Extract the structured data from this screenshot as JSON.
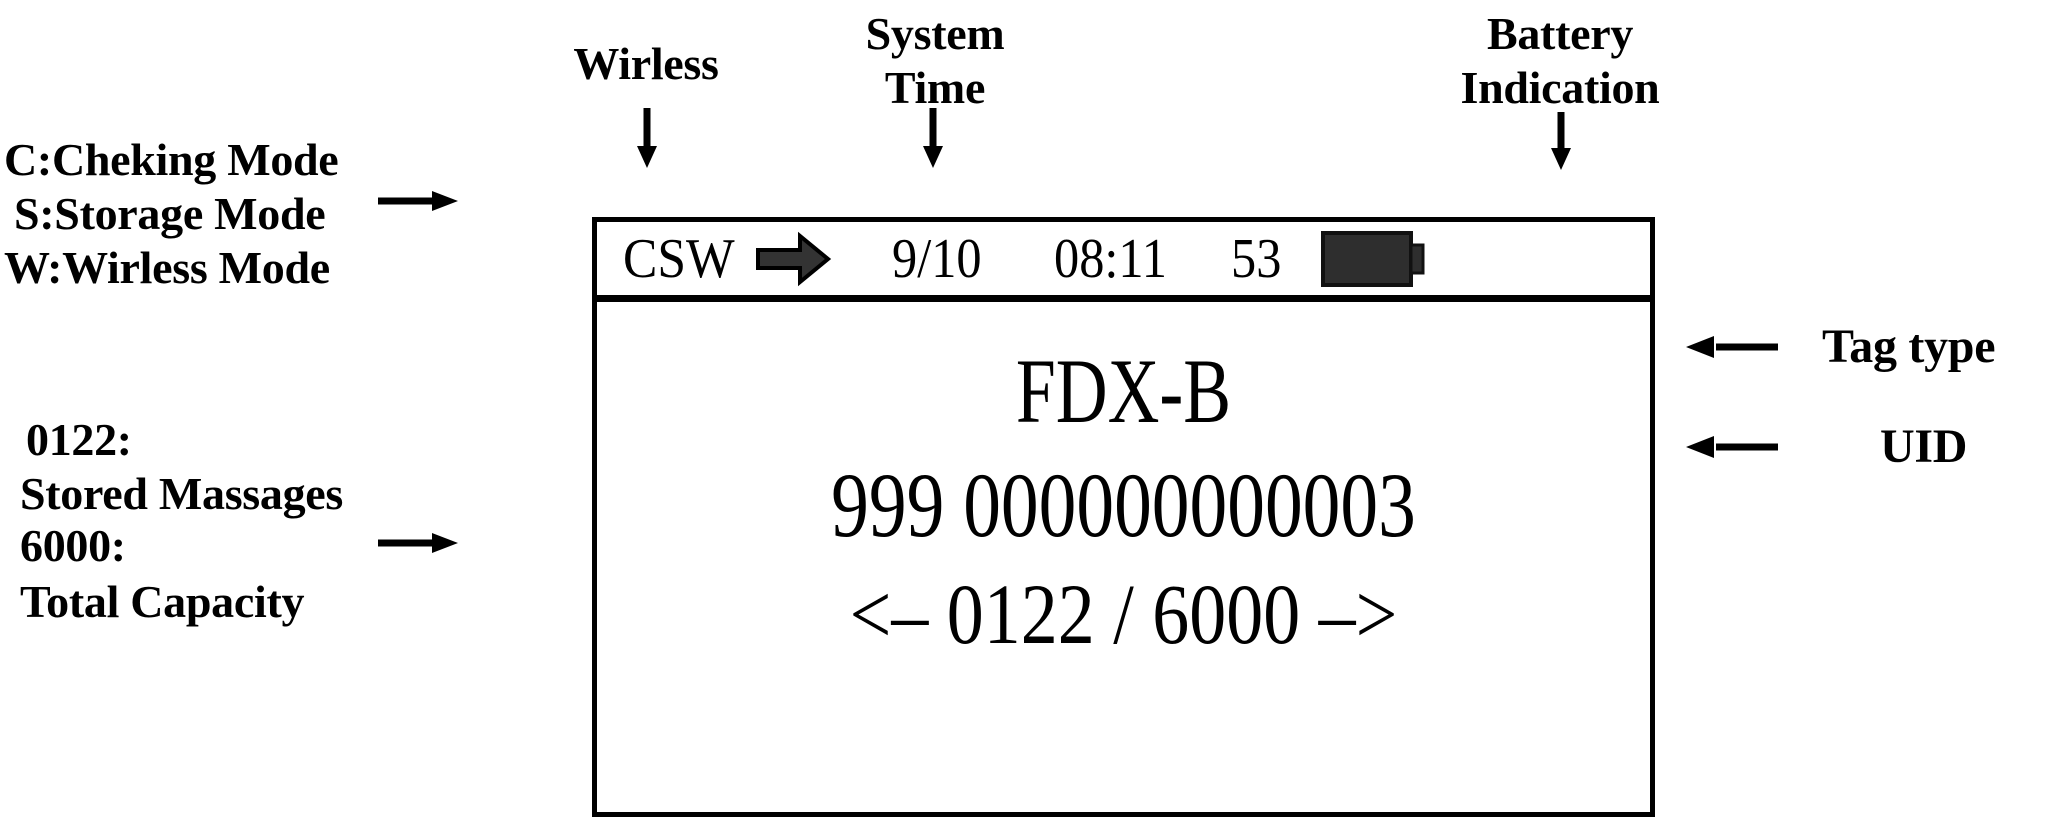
{
  "annotations": {
    "wireless": {
      "label": "Wirless",
      "icon": "down-arrow-icon"
    },
    "system_time": {
      "line1": "System",
      "line2": "Time",
      "icon": "down-arrow-icon"
    },
    "battery": {
      "line1": "Battery",
      "line2": "Indication",
      "icon": "down-arrow-icon"
    },
    "mode_legend": {
      "line1": "C:Cheking Mode",
      "line2": "S:Storage Mode",
      "line3": "W:Wirless Mode",
      "icon": "right-arrow-icon"
    },
    "stored_messages": {
      "line1": "0122:",
      "line2": "Stored Massages"
    },
    "total_capacity": {
      "line1": "6000:",
      "line2": "Total Capacity",
      "icon": "right-arrow-icon"
    },
    "tag_type": {
      "label": "Tag type",
      "icon": "left-arrow-icon"
    },
    "uid": {
      "label": "UID",
      "icon": "left-arrow-icon"
    }
  },
  "screen": {
    "status_bar": {
      "mode": "CSW",
      "wireless_icon": "solid-right-arrow-icon",
      "date": "9/10",
      "time": "08:11",
      "battery_percent": "53",
      "battery_icon": "battery-full-icon"
    },
    "tag_type": "FDX-B",
    "uid": "999 000000000003",
    "page_indicator": "<–  0122  / 6000  –>",
    "record_index": "0122",
    "record_total": "6000",
    "prev_arrow": "<–",
    "next_arrow": "–>"
  },
  "colors": {
    "ink": "#000000",
    "background": "#ffffff",
    "icon_fill": "#333333",
    "battery_fill": "#2e2e2e"
  }
}
